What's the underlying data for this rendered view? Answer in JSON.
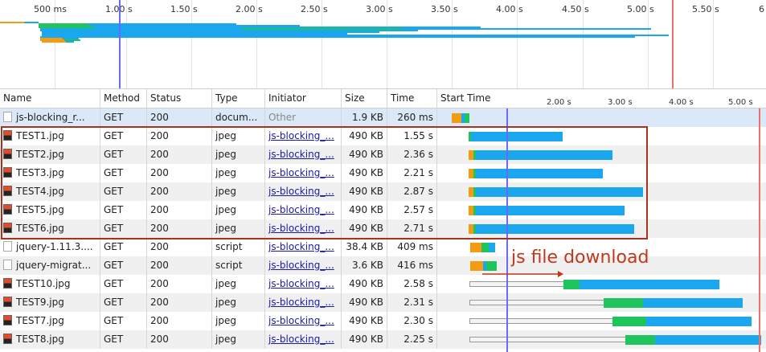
{
  "overview": {
    "ticks": [
      "500 ms",
      "1.00 s",
      "1.50 s",
      "2.00 s",
      "2.50 s",
      "3.00 s",
      "3.50 s",
      "4.00 s",
      "4.50 s",
      "5.00 s",
      "5.50 s",
      "6"
    ]
  },
  "columns": {
    "name": "Name",
    "method": "Method",
    "status": "Status",
    "type": "Type",
    "initiator": "Initiator",
    "size": "Size",
    "time": "Time",
    "start_time": "Start Time"
  },
  "waterfall_ticks": [
    "2.00 s",
    "3.00 s",
    "4.00 s",
    "5.00 s"
  ],
  "rows": [
    {
      "name": "js-blocking_r...",
      "method": "GET",
      "status": "200",
      "type": "docum...",
      "initiator": "Other",
      "size": "1.9 KB",
      "time": "260 ms",
      "icon": "doc",
      "selected": true
    },
    {
      "name": "TEST1.jpg",
      "method": "GET",
      "status": "200",
      "type": "jpeg",
      "initiator": "js-blocking_...",
      "size": "490 KB",
      "time": "1.55 s",
      "icon": "img"
    },
    {
      "name": "TEST2.jpg",
      "method": "GET",
      "status": "200",
      "type": "jpeg",
      "initiator": "js-blocking_...",
      "size": "490 KB",
      "time": "2.36 s",
      "icon": "img"
    },
    {
      "name": "TEST3.jpg",
      "method": "GET",
      "status": "200",
      "type": "jpeg",
      "initiator": "js-blocking_...",
      "size": "490 KB",
      "time": "2.21 s",
      "icon": "img"
    },
    {
      "name": "TEST4.jpg",
      "method": "GET",
      "status": "200",
      "type": "jpeg",
      "initiator": "js-blocking_...",
      "size": "490 KB",
      "time": "2.87 s",
      "icon": "img"
    },
    {
      "name": "TEST5.jpg",
      "method": "GET",
      "status": "200",
      "type": "jpeg",
      "initiator": "js-blocking_...",
      "size": "490 KB",
      "time": "2.57 s",
      "icon": "img"
    },
    {
      "name": "TEST6.jpg",
      "method": "GET",
      "status": "200",
      "type": "jpeg",
      "initiator": "js-blocking_...",
      "size": "490 KB",
      "time": "2.71 s",
      "icon": "img"
    },
    {
      "name": "jquery-1.11.3....",
      "method": "GET",
      "status": "200",
      "type": "script",
      "initiator": "js-blocking_...",
      "size": "38.4 KB",
      "time": "409 ms",
      "icon": "script"
    },
    {
      "name": "jquery-migrat...",
      "method": "GET",
      "status": "200",
      "type": "script",
      "initiator": "js-blocking_...",
      "size": "3.6 KB",
      "time": "416 ms",
      "icon": "script"
    },
    {
      "name": "TEST10.jpg",
      "method": "GET",
      "status": "200",
      "type": "jpeg",
      "initiator": "js-blocking_...",
      "size": "490 KB",
      "time": "2.58 s",
      "icon": "img"
    },
    {
      "name": "TEST9.jpg",
      "method": "GET",
      "status": "200",
      "type": "jpeg",
      "initiator": "js-blocking_...",
      "size": "490 KB",
      "time": "2.31 s",
      "icon": "img"
    },
    {
      "name": "TEST7.jpg",
      "method": "GET",
      "status": "200",
      "type": "jpeg",
      "initiator": "js-blocking_...",
      "size": "490 KB",
      "time": "2.30 s",
      "icon": "img"
    },
    {
      "name": "TEST8.jpg",
      "method": "GET",
      "status": "200",
      "type": "jpeg",
      "initiator": "js-blocking_...",
      "size": "490 KB",
      "time": "2.25 s",
      "icon": "img"
    }
  ],
  "annotation": "js file download",
  "colors": {
    "waiting": "#f39c12",
    "receiving_green": "#1ec45c",
    "download_blue": "#1aa7f0",
    "dom_loaded_line": "#6a6aff",
    "load_line": "#ef6f6f",
    "highlight_border": "#a8321c",
    "selected_row": "#dbe8f8",
    "alt_row": "#f0f0f0"
  }
}
